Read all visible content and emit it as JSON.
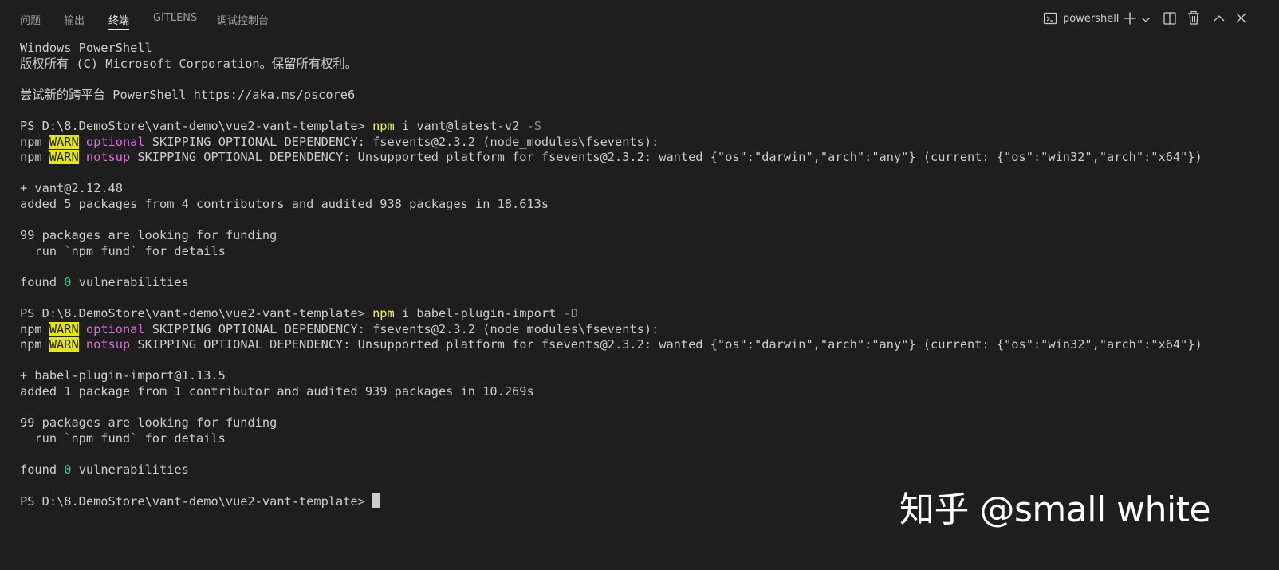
{
  "tabs": [
    {
      "label": "问题"
    },
    {
      "label": "输出"
    },
    {
      "label": "终端"
    },
    {
      "label": "GITLENS"
    },
    {
      "label": "调试控制台"
    }
  ],
  "toolbar": {
    "shell_name": "powershell",
    "icons": [
      "terminal-icon",
      "plus-icon",
      "chevron-down-icon",
      "split-icon",
      "trash-icon",
      "chevron-up-icon",
      "close-icon"
    ]
  },
  "terminal": {
    "header1": "Windows PowerShell",
    "header2": "版权所有 (C) Microsoft Corporation。保留所有权利。",
    "header3": "尝试新的跨平台 PowerShell https://aka.ms/pscore6",
    "prompt": "PS D:\\8.DemoStore\\vant-demo\\vue2-vant-template> ",
    "cmd1": {
      "npm": "npm",
      "args": " i vant@latest-v2 ",
      "flag": "-S"
    },
    "cmd2": {
      "npm": "npm",
      "args": " i babel-plugin-import ",
      "flag": "-D"
    },
    "npm": "npm ",
    "warn": "WARN",
    "optional": "optional",
    "notsup": "notsup",
    "optional_rest": " SKIPPING OPTIONAL DEPENDENCY: fsevents@2.3.2 (node_modules\\fsevents):",
    "notsup_rest": " SKIPPING OPTIONAL DEPENDENCY: Unsupported platform for fsevents@2.3.2: wanted {\"os\":\"darwin\",\"arch\":\"any\"} (current: {\"os\":\"win32\",\"arch\":\"x64\"})",
    "installed1": "+ vant@2.12.48",
    "added1": "added 5 packages from 4 contributors and audited 938 packages in 18.613s",
    "installed2": "+ babel-plugin-import@1.13.5",
    "added2": "added 1 package from 1 contributor and audited 939 packages in 10.269s",
    "funding": "99 packages are looking for funding",
    "fund_hint": "  run `npm fund` for details",
    "found_prefix": "found ",
    "found_count": "0",
    "found_suffix": " vulnerabilities"
  },
  "watermark": "知乎 @small white"
}
